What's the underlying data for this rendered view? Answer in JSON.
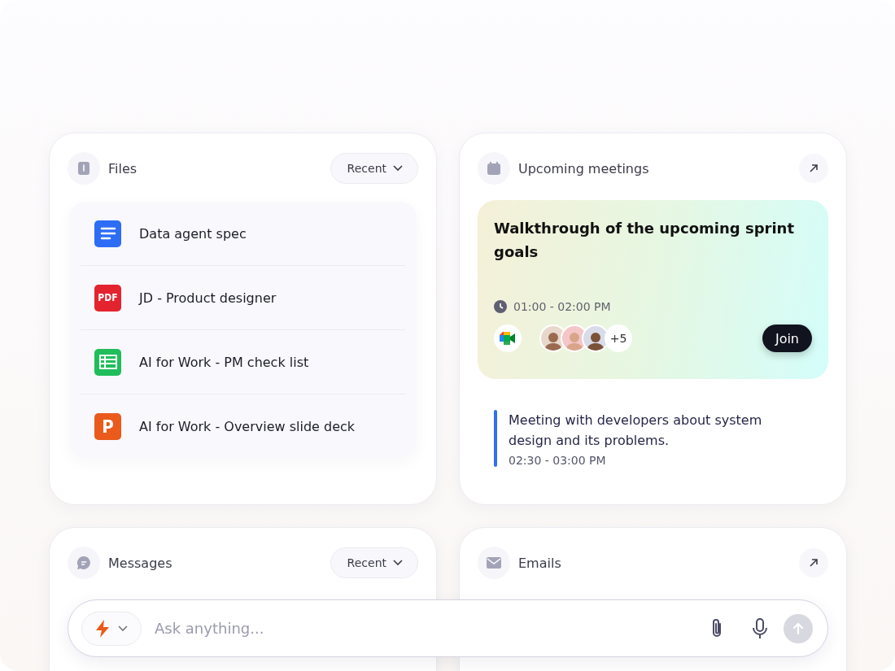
{
  "files": {
    "title": "Files",
    "filter": "Recent",
    "items": [
      {
        "kind": "doc",
        "name": "Data agent spec"
      },
      {
        "kind": "pdf",
        "icon_label": "PDF",
        "name": "JD - Product designer"
      },
      {
        "kind": "sheet",
        "name": "AI for Work - PM check list"
      },
      {
        "kind": "slides",
        "icon_label": "P",
        "name": "AI for Work - Overview slide deck"
      }
    ]
  },
  "meetings": {
    "title": "Upcoming meetings",
    "featured": {
      "title": "Walkthrough of the upcoming sprint goals",
      "time": "01:00 - 02:00 PM",
      "extra_attendees": "+5",
      "join": "Join"
    },
    "next": {
      "title": "Meeting with developers about system design and its problems.",
      "time": "02:30 - 03:00 PM"
    }
  },
  "messages": {
    "title": "Messages",
    "filter": "Recent"
  },
  "emails": {
    "title": "Emails"
  },
  "composer": {
    "placeholder": "Ask anything..."
  }
}
